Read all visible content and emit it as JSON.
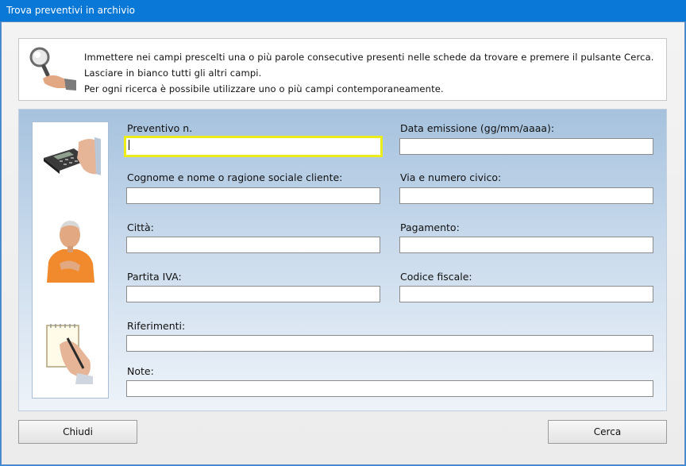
{
  "window": {
    "title": "Trova preventivi in archivio"
  },
  "info": {
    "lines": [
      "Immettere nei campi prescelti una o più parole consecutive presenti nelle schede da trovare e premere il pulsante Cerca.",
      "Lasciare in bianco tutti gli altri campi.",
      "Per ogni ricerca è possibile utilizzare uno o più campi contemporaneamente."
    ]
  },
  "fields": {
    "preventivo": {
      "label": "Preventivo n.",
      "value": ""
    },
    "data_emissione": {
      "label": "Data emissione (gg/mm/aaaa):",
      "value": ""
    },
    "cliente": {
      "label": "Cognome e nome o ragione sociale cliente:",
      "value": ""
    },
    "via": {
      "label": "Via e numero civico:",
      "value": ""
    },
    "citta": {
      "label": "Città:",
      "value": ""
    },
    "pagamento": {
      "label": "Pagamento:",
      "value": ""
    },
    "partita_iva": {
      "label": "Partita IVA:",
      "value": ""
    },
    "codice_fiscale": {
      "label": "Codice fiscale:",
      "value": ""
    },
    "riferimenti": {
      "label": "Riferimenti:",
      "value": ""
    },
    "note": {
      "label": "Note:",
      "value": ""
    }
  },
  "buttons": {
    "close": "Chiudi",
    "search": "Cerca"
  },
  "icons": [
    "magnifier-hand-icon",
    "calculator-icon",
    "person-icon",
    "notepad-writing-icon"
  ],
  "colors": {
    "titlebar": "#0a78d7",
    "focus_border": "#ecec1a",
    "panel_top": "#a6c2de"
  }
}
